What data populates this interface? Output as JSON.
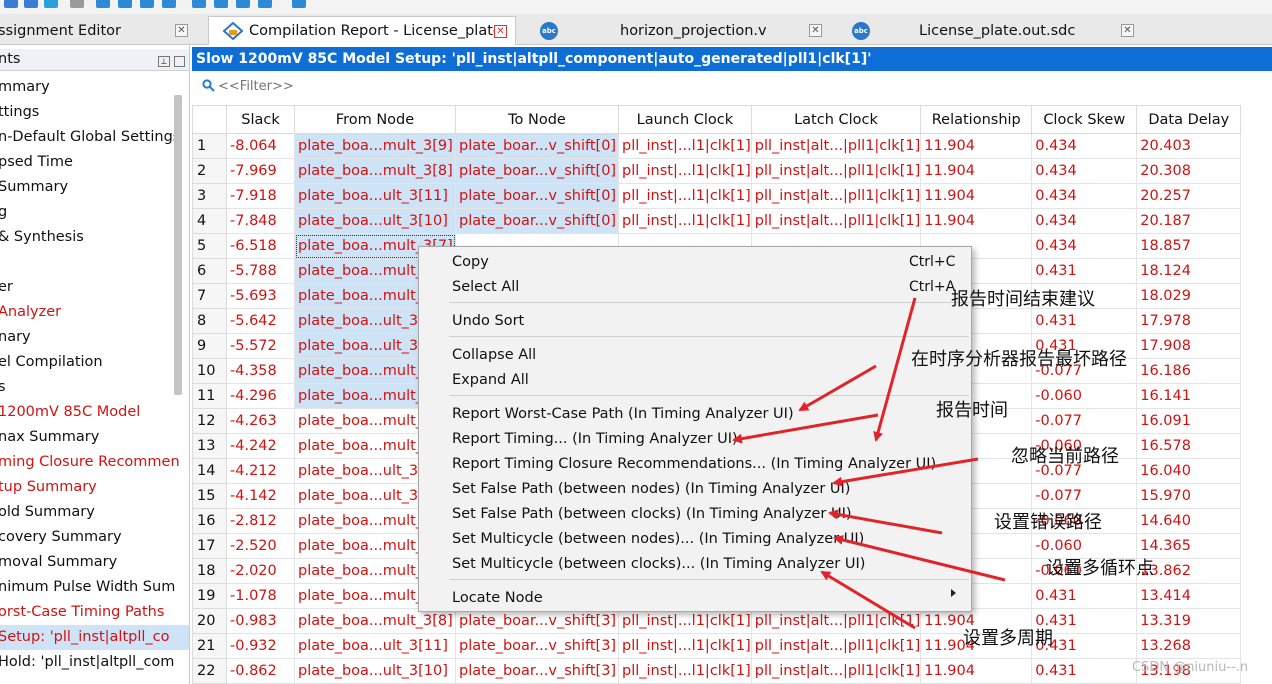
{
  "tabs": [
    {
      "label": "ssignment Editor"
    },
    {
      "label": "Compilation Report - License_plate"
    },
    {
      "label": "horizon_projection.v"
    },
    {
      "label": "License_plate.out.sdc"
    }
  ],
  "left_panel": {
    "header": "nts",
    "items": [
      {
        "label": "mmary",
        "style": "normal"
      },
      {
        "label": "ttings",
        "style": "normal"
      },
      {
        "label": "n-Default Global Settings",
        "style": "normal"
      },
      {
        "label": "psed Time",
        "style": "normal"
      },
      {
        "label": " Summary",
        "style": "normal"
      },
      {
        "label": "g",
        "style": "normal"
      },
      {
        "label": " & Synthesis",
        "style": "normal"
      },
      {
        "label": "",
        "style": "normal"
      },
      {
        "label": "er",
        "style": "normal"
      },
      {
        "label": "Analyzer",
        "style": "red"
      },
      {
        "label": "nary",
        "style": "normal"
      },
      {
        "label": "el Compilation",
        "style": "normal"
      },
      {
        "label": "s",
        "style": "normal"
      },
      {
        "label": "1200mV 85C Model",
        "style": "red"
      },
      {
        "label": "nax Summary",
        "style": "normal"
      },
      {
        "label": "ming Closure Recommen",
        "style": "red"
      },
      {
        "label": "tup Summary",
        "style": "red"
      },
      {
        "label": "old Summary",
        "style": "normal"
      },
      {
        "label": "covery Summary",
        "style": "normal"
      },
      {
        "label": "moval Summary",
        "style": "normal"
      },
      {
        "label": "nimum Pulse Width Sum",
        "style": "normal"
      },
      {
        "label": "orst-Case Timing Paths",
        "style": "red"
      },
      {
        "label": " Setup: 'pll_inst|altpll_co",
        "style": "selected"
      },
      {
        "label": " Hold: 'pll_inst|altpll_com",
        "style": "normal"
      }
    ]
  },
  "panel_title": "Slow 1200mV 85C Model Setup: 'pll_inst|altpll_component|auto_generated|pll1|clk[1]'",
  "filter": {
    "placeholder": "<<Filter>>"
  },
  "table": {
    "columns": [
      "",
      "Slack",
      "From Node",
      "To Node",
      "Launch Clock",
      "Latch Clock",
      "Relationship",
      "Clock Skew",
      "Data Delay"
    ],
    "rows": [
      [
        "1",
        "-8.064",
        "plate_boa...mult_3[9]",
        "plate_boar...v_shift[0]",
        "pll_inst|...l1|clk[1]",
        "pll_inst|alt...|pll1|clk[1]",
        "11.904",
        "0.434",
        "20.403"
      ],
      [
        "2",
        "-7.969",
        "plate_boa...mult_3[8]",
        "plate_boar...v_shift[0]",
        "pll_inst|...l1|clk[1]",
        "pll_inst|alt...|pll1|clk[1]",
        "11.904",
        "0.434",
        "20.308"
      ],
      [
        "3",
        "-7.918",
        "plate_boa...ult_3[11]",
        "plate_boar...v_shift[0]",
        "pll_inst|...l1|clk[1]",
        "pll_inst|alt...|pll1|clk[1]",
        "11.904",
        "0.434",
        "20.257"
      ],
      [
        "4",
        "-7.848",
        "plate_boa...ult_3[10]",
        "plate_boar...v_shift[0]",
        "pll_inst|...l1|clk[1]",
        "pll_inst|alt...|pll1|clk[1]",
        "11.904",
        "0.434",
        "20.187"
      ],
      [
        "5",
        "-6.518",
        "plate_boa...mult_3[7]",
        "",
        "",
        "",
        "",
        "0.434",
        "18.857"
      ],
      [
        "6",
        "-5.788",
        "plate_boa...mult_",
        "",
        "",
        "",
        "",
        "0.431",
        "18.124"
      ],
      [
        "7",
        "-5.693",
        "plate_boa...mult_",
        "",
        "",
        "",
        "",
        "",
        "18.029"
      ],
      [
        "8",
        "-5.642",
        "plate_boa...ult_3[",
        "",
        "",
        "",
        "",
        "0.431",
        "17.978"
      ],
      [
        "9",
        "-5.572",
        "plate_boa...ult_3[",
        "",
        "",
        "",
        "",
        "0.431",
        "17.908"
      ],
      [
        "10",
        "-4.358",
        "plate_boa...mult_",
        "",
        "",
        "",
        "",
        "-0.077",
        "16.186"
      ],
      [
        "11",
        "-4.296",
        "plate_boa...mult_",
        "",
        "",
        "",
        "",
        "-0.060",
        "16.141"
      ],
      [
        "12",
        "-4.263",
        "plate_boa...mult_",
        "",
        "",
        "",
        "",
        "-0.077",
        "16.091"
      ],
      [
        "13",
        "-4.242",
        "plate_boa...mult_",
        "",
        "",
        "",
        "",
        "-0.060",
        "16.578"
      ],
      [
        "14",
        "-4.212",
        "plate_boa...ult_3[",
        "",
        "",
        "",
        "",
        "-0.077",
        "16.040"
      ],
      [
        "15",
        "-4.142",
        "plate_boa...ult_3[",
        "",
        "",
        "",
        "",
        "-0.077",
        "15.970"
      ],
      [
        "16",
        "-2.812",
        "plate_boa...mult_",
        "",
        "",
        "",
        "",
        "-0.060",
        "14.640"
      ],
      [
        "17",
        "-2.520",
        "plate_boa...mult_",
        "",
        "",
        "",
        "",
        "-0.060",
        "14.365"
      ],
      [
        "18",
        "-2.020",
        "plate_boa...mult_",
        "",
        "",
        "",
        "",
        "-0.060",
        "13.862"
      ],
      [
        "19",
        "-1.078",
        "plate_boa...mult_",
        "",
        "",
        "",
        "",
        "0.431",
        "13.414"
      ],
      [
        "20",
        "-0.983",
        "plate_boa...mult_3[8]",
        "plate_boar...v_shift[3]",
        "pll_inst|...l1|clk[1]",
        "pll_inst|alt...|pll1|clk[1]",
        "11.904",
        "0.431",
        "13.319"
      ],
      [
        "21",
        "-0.932",
        "plate_boa...ult_3[11]",
        "plate_boar...v_shift[3]",
        "pll_inst|...l1|clk[1]",
        "pll_inst|alt...|pll1|clk[1]",
        "11.904",
        "0.431",
        "13.268"
      ],
      [
        "22",
        "-0.862",
        "plate_boa...ult_3[10]",
        "plate_boar...v_shift[3]",
        "pll_inst|...l1|clk[1]",
        "pll_inst|alt...|pll1|clk[1]",
        "11.904",
        "0.431",
        "13.198"
      ]
    ]
  },
  "context_menu": {
    "copy": {
      "label": "Copy",
      "shortcut": "Ctrl+C"
    },
    "select_all": {
      "label": "Select All",
      "shortcut": "Ctrl+A"
    },
    "undo_sort": "Undo Sort",
    "collapse_all": "Collapse All",
    "expand_all": "Expand All",
    "report_worst_case": "Report Worst-Case Path (In Timing Analyzer UI)",
    "report_timing": "Report Timing... (In Timing Analyzer UI)",
    "report_closure": "Report Timing Closure Recommendations... (In Timing Analyzer UI)",
    "false_path_nodes": "Set False Path (between nodes) (In Timing Analyzer UI)",
    "false_path_clocks": "Set False Path (between clocks) (In Timing Analyzer UI)",
    "multicycle_nodes": "Set Multicycle (between nodes)... (In Timing Analyzer UI)",
    "multicycle_clocks": "Set Multicycle (between clocks)... (In Timing Analyzer UI)",
    "locate_node": "Locate Node"
  },
  "annotations": {
    "a1": "报告时间结束建议",
    "a2": "在时序分析器报告最坏路径",
    "a3": "报告时间",
    "a4": "忽略当前路径",
    "a5": "设置错误路径",
    "a6": "设置多循环点",
    "a7": "设置多周期"
  },
  "watermark": "CSDN @niuniu--.n",
  "colors": {
    "accent": "#0f6dd6",
    "error_text": "#d01212",
    "selection": "#cfe3f7",
    "arrow": "#e0242a"
  }
}
